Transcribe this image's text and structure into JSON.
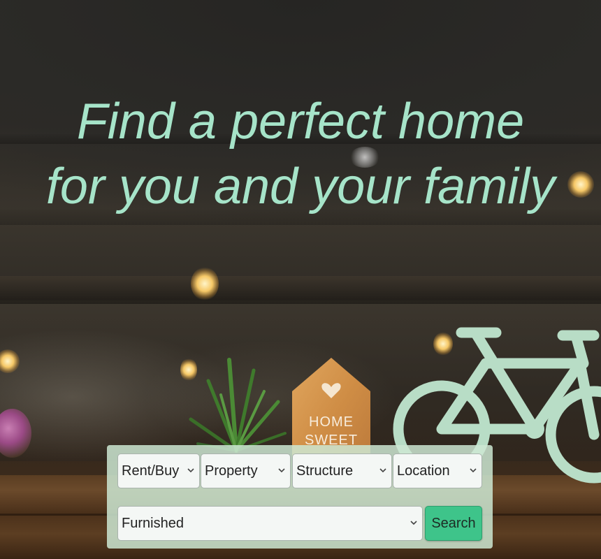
{
  "hero": {
    "headline": "Find a perfect home for you and your family",
    "background_image": "cafe-window-home-sweet-home-bicycle",
    "house_sign": {
      "line1": "HOME",
      "line2": "SWEET"
    }
  },
  "search": {
    "rent_buy": {
      "selected": "Rent/Buy"
    },
    "property": {
      "selected": "Property"
    },
    "structure": {
      "selected": "Structure"
    },
    "location": {
      "selected": "Location"
    },
    "furnished": {
      "selected": "Furnished"
    },
    "submit_label": "Search"
  },
  "colors": {
    "headline": "#a6e4c9",
    "panel": "#cde8d2",
    "search_button": "#3ec48a"
  },
  "icons": {
    "dropdown": "chevron-down-icon"
  }
}
